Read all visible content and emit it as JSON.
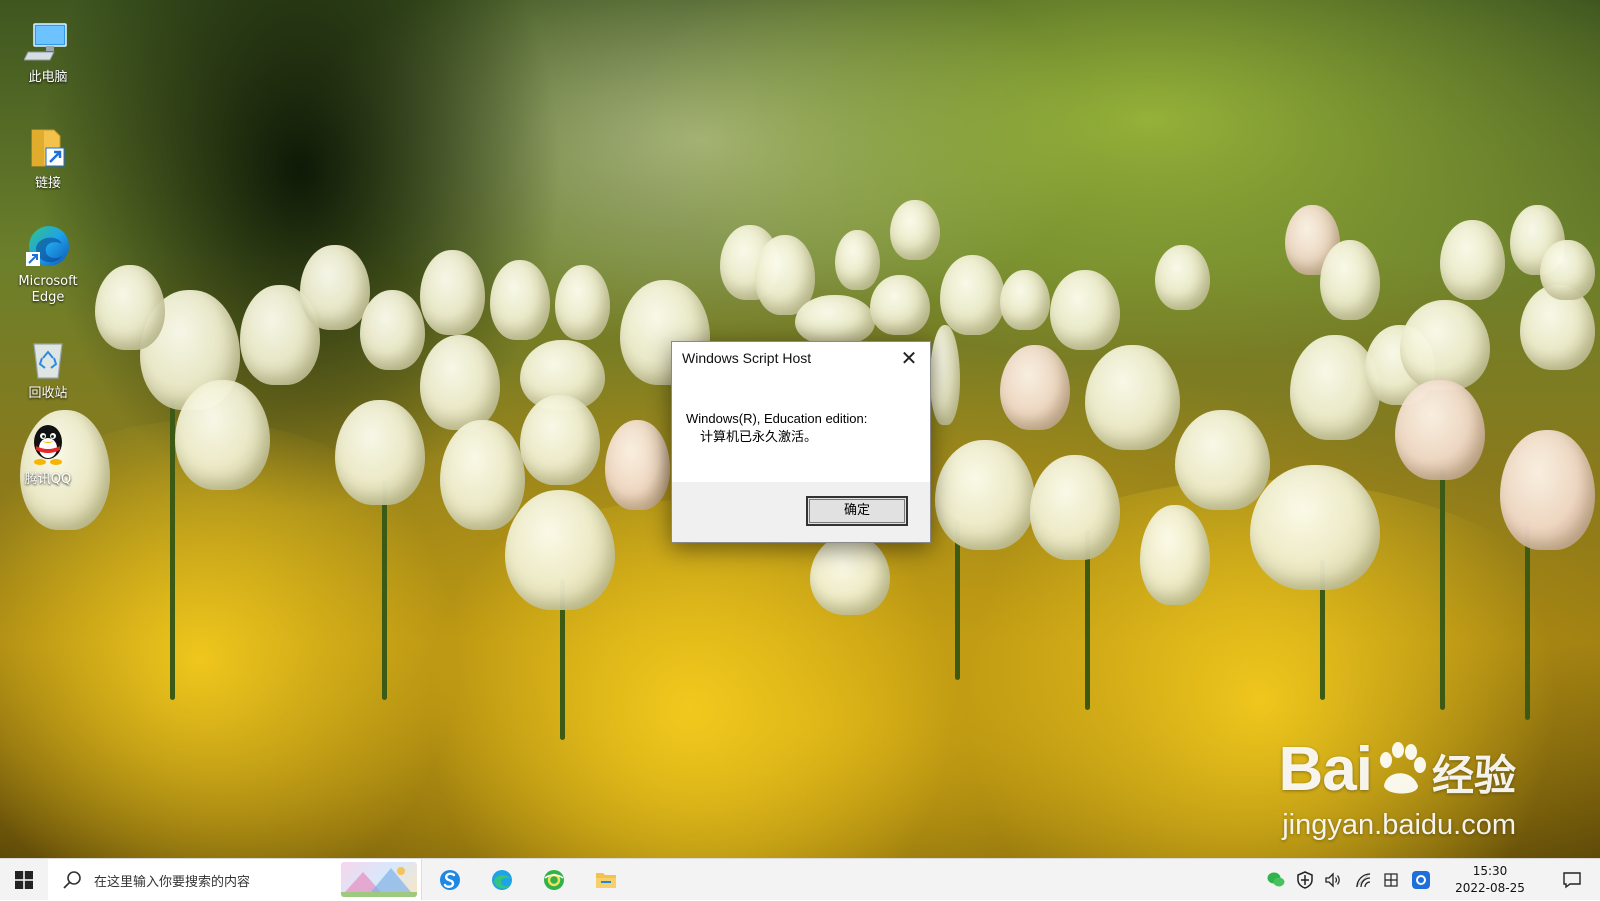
{
  "desktop": {
    "icons": [
      {
        "label": "此电脑",
        "icon": "this-pc-icon"
      },
      {
        "label": "链接",
        "icon": "folder-shortcut-icon"
      },
      {
        "label_line1": "Microsoft",
        "label_line2": "Edge",
        "icon": "edge-icon"
      },
      {
        "label": "回收站",
        "icon": "recycle-bin-icon"
      },
      {
        "label": "腾讯QQ",
        "icon": "qq-penguin-icon"
      }
    ]
  },
  "dialog": {
    "title": "Windows Script Host",
    "message_line1": "Windows(R), Education edition:",
    "message_line2": "计算机已永久激活。",
    "ok_label": "确定",
    "close_glyph": "✕"
  },
  "watermark": {
    "brand_prefix": "Bai",
    "brand_suffix": "经验",
    "domain": "jingyan.baidu.com"
  },
  "taskbar": {
    "search_placeholder": "在这里输入你要搜索的内容",
    "pinned": [
      "sogou-browser-icon",
      "edge-icon",
      "360-browser-icon",
      "file-explorer-icon"
    ],
    "tray": [
      "wechat-icon",
      "security-shield-icon",
      "volume-icon",
      "network-icon",
      "input-method-icon",
      "qq-tray-icon"
    ],
    "time": "15:30",
    "date": "2022-08-25",
    "colors": {
      "accent_blue": "#1e6fd9",
      "taskbar_bg": "#f3f3f3"
    }
  }
}
